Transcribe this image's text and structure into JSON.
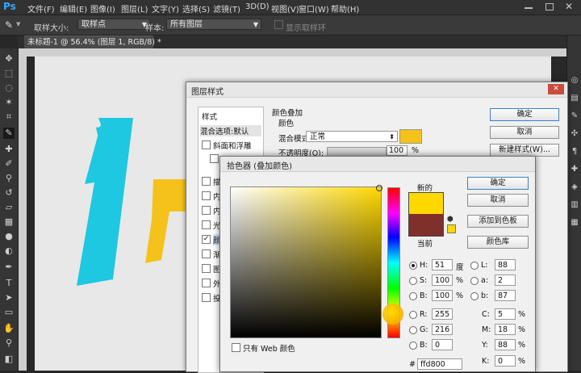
{
  "app": {
    "logo": "Ps"
  },
  "menubar": [
    "文件(F)",
    "编辑(E)",
    "图像(I)",
    "图层(L)",
    "文字(Y)",
    "选择(S)",
    "滤镜(T)",
    "3D(D)",
    "视图(V)",
    "窗口(W)",
    "帮助(H)"
  ],
  "options_bar": {
    "sample_size_label": "取样大小:",
    "sample_size_value": "取样点",
    "sample_label": "样本:",
    "sample_value": "所有图层",
    "show_ring_label": "显示取样环"
  },
  "document_tab": "未标题-1 @ 56.4% (图层 1, RGB/8) *",
  "layer_style": {
    "title": "图层样式",
    "list": {
      "header": "样式",
      "blend_default": "混合选项:默认",
      "bevel": "斜面和浮雕",
      "stroke_partial": "描",
      "inner_partial": "内",
      "inner2_partial": "内",
      "light_partial": "光",
      "color_overlay_partial": "颜",
      "gradient_partial": "渐",
      "pattern_partial": "图",
      "outer_partial": "外",
      "shadow_partial": "投"
    },
    "section_title": "颜色叠加",
    "sub_title": "颜色",
    "blend_mode_label": "混合模式:",
    "blend_mode_value": "正常",
    "opacity_label": "不透明度(O):",
    "opacity_value": "100",
    "opacity_unit": "%",
    "buttons": {
      "ok": "确定",
      "cancel": "取消",
      "new_style": "新建样式(W)..."
    },
    "overlay_color": "#f4c21a"
  },
  "color_picker": {
    "title": "拾色器 (叠加颜色)",
    "new_label": "新的",
    "current_label": "当前",
    "new_color": "#ffd800",
    "current_color": "#80302a",
    "buttons": {
      "ok": "确定",
      "cancel": "取消",
      "add_swatch": "添加到色板",
      "libraries": "颜色库"
    },
    "web_only_label": "只有 Web 颜色",
    "fields": {
      "H": {
        "label": "H:",
        "value": "51",
        "unit": "度"
      },
      "S": {
        "label": "S:",
        "value": "100",
        "unit": "%"
      },
      "B": {
        "label": "B:",
        "value": "100",
        "unit": "%"
      },
      "R": {
        "label": "R:",
        "value": "255"
      },
      "G": {
        "label": "G:",
        "value": "216"
      },
      "Bb": {
        "label": "B:",
        "value": "0"
      },
      "L": {
        "label": "L:",
        "value": "88"
      },
      "a": {
        "label": "a:",
        "value": "2"
      },
      "b": {
        "label": "b:",
        "value": "87"
      },
      "C": {
        "label": "C:",
        "value": "5",
        "unit": "%"
      },
      "M": {
        "label": "M:",
        "value": "18",
        "unit": "%"
      },
      "Y": {
        "label": "Y:",
        "value": "88",
        "unit": "%"
      },
      "K": {
        "label": "K:",
        "value": "0",
        "unit": "%"
      },
      "hex": {
        "label": "#",
        "value": "ffd800"
      }
    }
  },
  "canvas": {
    "shape_colors": {
      "cyan": "#1ec8e0",
      "yellow": "#f4c21a"
    }
  }
}
